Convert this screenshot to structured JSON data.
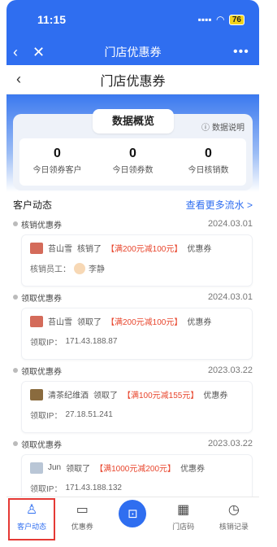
{
  "status_bar": {
    "time": "11:15",
    "signal": ".... ",
    "battery": "76"
  },
  "app_nav": {
    "back_icon": "chevron-left",
    "close_icon": "close",
    "title": "门店优惠券",
    "more_icon": "more"
  },
  "page_header": {
    "title": "门店优惠券"
  },
  "overview": {
    "tab_label": "数据概览",
    "help_label": "数据说明",
    "stats": [
      {
        "value": "0",
        "label": "今日领券客户"
      },
      {
        "value": "0",
        "label": "今日领券数"
      },
      {
        "value": "0",
        "label": "今日核销数"
      }
    ]
  },
  "dynamics": {
    "section_label": "客户动态",
    "more_link": "查看更多流水 >",
    "entries": [
      {
        "type": "核销优惠券",
        "date": "2024.03.01",
        "name": "苔山雪",
        "action": "核销了",
        "coupon": "【满200元减100元】",
        "suffix": "优惠券",
        "detail_label": "核销员工：",
        "detail_value": "李静"
      },
      {
        "type": "领取优惠券",
        "date": "2024.03.01",
        "name": "苔山雪",
        "action": "领取了",
        "coupon": "【满200元减100元】",
        "suffix": "优惠券",
        "detail_label": "领取IP：",
        "detail_value": "171.43.188.87"
      },
      {
        "type": "领取优惠券",
        "date": "2023.03.22",
        "name": "清茶纪维酒",
        "action": "领取了",
        "coupon": "【满100元减155元】",
        "suffix": "优惠券",
        "detail_label": "领取IP：",
        "detail_value": "27.18.51.241"
      },
      {
        "type": "领取优惠券",
        "date": "2023.03.22",
        "name": "Jun",
        "action": "领取了",
        "coupon": "【满1000元减200元】",
        "suffix": "优惠券",
        "detail_label": "领取IP：",
        "detail_value": "171.43.188.132"
      }
    ]
  },
  "tab_bar": {
    "tabs": [
      {
        "label": "客户动态",
        "active": true
      },
      {
        "label": "优惠券"
      },
      {
        "label": ""
      },
      {
        "label": "门店码"
      },
      {
        "label": "核销记录"
      }
    ]
  },
  "colors": {
    "brand": "#2f6ef0",
    "coupon": "#e8452c",
    "highlight": "#e53935"
  }
}
